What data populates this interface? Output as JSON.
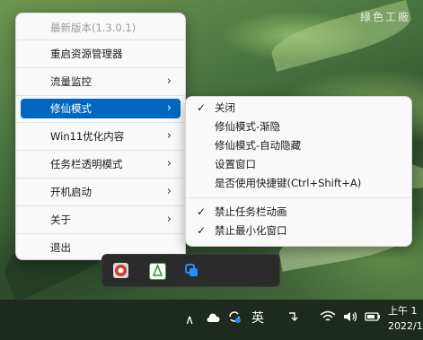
{
  "desktop": {
    "watermark": "綠色工廠"
  },
  "context_menu": {
    "items": [
      {
        "label": "最新版本(1.3.0.1)",
        "disabled": true
      },
      {
        "label": "重启资源管理器"
      },
      {
        "label": "流量监控",
        "arrow": "›"
      },
      {
        "label": "修仙模式",
        "arrow": "›",
        "active": true
      },
      {
        "label": "Win11优化内容",
        "arrow": "›"
      },
      {
        "label": "任务栏透明模式",
        "arrow": "›"
      },
      {
        "label": "开机启动",
        "arrow": "›"
      },
      {
        "label": "关于",
        "arrow": "›"
      },
      {
        "label": "退出"
      }
    ]
  },
  "submenu": {
    "items": [
      {
        "label": "关闭",
        "checked": true
      },
      {
        "label": "修仙模式-渐隐"
      },
      {
        "label": "修仙模式-自动隐藏"
      },
      {
        "label": "设置窗口"
      },
      {
        "label": "是否使用快捷键(Ctrl+Shift+A)"
      },
      {
        "label": "禁止任务栏动画",
        "checked": true
      },
      {
        "label": "禁止最小化窗口",
        "checked": true
      }
    ],
    "check_glyph": "✓"
  },
  "tray_overflow": {
    "icons": [
      "app-red-icon",
      "app-leaf-icon",
      "app-blue-squares-icon"
    ]
  },
  "taskbar": {
    "chevron": "∧",
    "ime": "英",
    "clock_line1": "上午 1",
    "clock_line2": "2022/1"
  }
}
